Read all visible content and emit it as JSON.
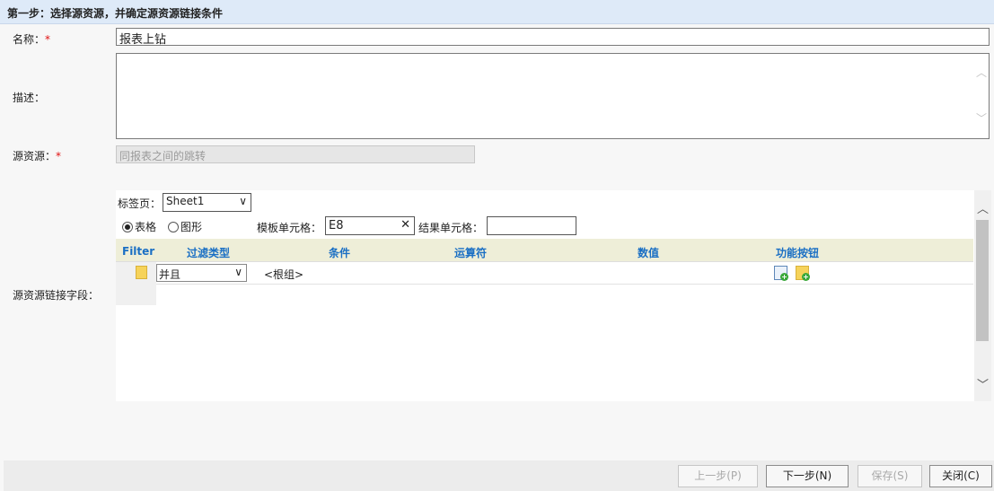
{
  "header": {
    "title": "第一步：选择源资源，并确定源资源链接条件"
  },
  "form": {
    "name_label": "名称：",
    "name_required": "*",
    "name_value": "报表上钻",
    "desc_label": "描述：",
    "source_label": "源资源：",
    "source_required": "*",
    "source_value": "同报表之间的跳转",
    "link_field_label": "源资源链接字段："
  },
  "link_panel": {
    "tab_label": "标签页：",
    "tab_selected": "Sheet1",
    "radio_table": "表格",
    "radio_chart": "图形",
    "radio_selected": "table",
    "template_cell_label": "模板单元格：",
    "template_cell_value": "E8",
    "result_cell_label": "结果单元格：",
    "result_cell_value": ""
  },
  "grid": {
    "columns": [
      "Filter",
      "过滤类型",
      "条件",
      "运算符",
      "数值",
      "功能按钮"
    ],
    "row": {
      "filter_type": "并且",
      "condition": "<根组>"
    }
  },
  "footer": {
    "prev": "上一步(P)",
    "next": "下一步(N)",
    "save": "保存(S)",
    "close": "关闭(C)"
  },
  "colors": {
    "header_bg": "#deeaf8",
    "column_header_text": "#1a6fc4",
    "required": "#e01010"
  }
}
